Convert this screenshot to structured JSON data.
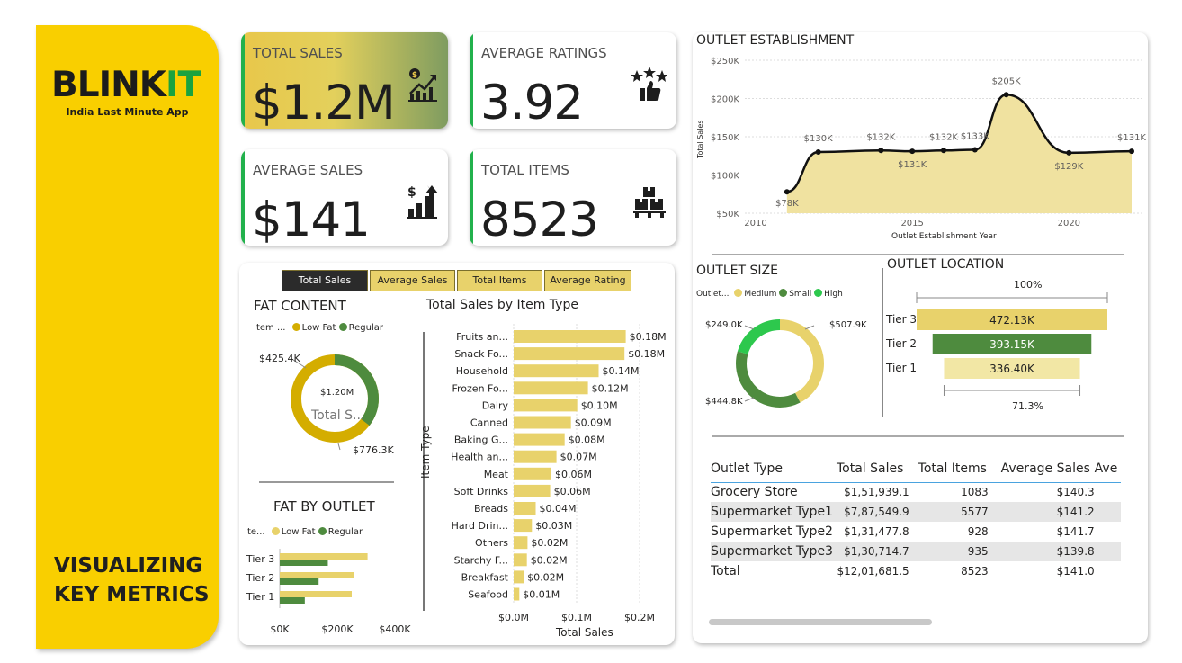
{
  "sidebar": {
    "brand_main": "BLINK",
    "brand_accent": "IT",
    "tagline": "India Last Minute App",
    "title_line1": "VISUALIZING",
    "title_line2": "KEY METRICS"
  },
  "kpis": [
    {
      "label": "TOTAL SALES",
      "value": "$1.2M",
      "icon": "sales-chart-icon"
    },
    {
      "label": "AVERAGE RATINGS",
      "value": "3.92",
      "icon": "rating-thumbs-up-icon"
    },
    {
      "label": "AVERAGE SALES",
      "value": "$141",
      "icon": "average-sales-icon"
    },
    {
      "label": "TOTAL ITEMS",
      "value": "8523",
      "icon": "items-boxes-icon"
    }
  ],
  "tabs": [
    "Total Sales",
    "Average Sales",
    "Total Items",
    "Average Rating"
  ],
  "fat_content": {
    "title": "FAT CONTENT",
    "legend_label": "Item ...",
    "center_value": "$1.20M",
    "center_label": "Total S...",
    "chart_data": {
      "type": "pie",
      "categories": [
        "Low Fat",
        "Regular"
      ],
      "values": [
        776.3,
        425.4
      ],
      "labels": [
        "$776.3K",
        "$425.4K"
      ],
      "total": "$1.20M"
    }
  },
  "fat_by_outlet": {
    "title": "FAT BY OUTLET",
    "legend_label": "Ite...",
    "chart_data": {
      "type": "bar",
      "orientation": "horizontal",
      "categories": [
        "Tier 3",
        "Tier 2",
        "Tier 1"
      ],
      "series": [
        {
          "name": "Low Fat",
          "values": [
            305,
            258,
            250
          ]
        },
        {
          "name": "Regular",
          "values": [
            167,
            135,
            87
          ]
        }
      ],
      "xlim": [
        0,
        400
      ],
      "ticks": [
        "$0K",
        "$200K",
        "$400K"
      ]
    }
  },
  "item_type": {
    "title": "Total Sales by Item Type",
    "ylabel": "Item Type",
    "xlabel": "Total Sales",
    "chart_data": {
      "type": "bar",
      "orientation": "horizontal",
      "categories": [
        "Fruits an...",
        "Snack Fo...",
        "Household",
        "Frozen Fo...",
        "Dairy",
        "Canned",
        "Baking G...",
        "Health an...",
        "Meat",
        "Soft Drinks",
        "Breads",
        "Hard Drin...",
        "Others",
        "Starchy F...",
        "Breakfast",
        "Seafood"
      ],
      "values": [
        0.178,
        0.176,
        0.135,
        0.118,
        0.101,
        0.091,
        0.081,
        0.068,
        0.06,
        0.058,
        0.035,
        0.029,
        0.022,
        0.021,
        0.016,
        0.009
      ],
      "labels": [
        "$0.18M",
        "$0.18M",
        "$0.14M",
        "$0.12M",
        "$0.10M",
        "$0.09M",
        "$0.08M",
        "$0.07M",
        "$0.06M",
        "$0.06M",
        "$0.04M",
        "$0.03M",
        "$0.02M",
        "$0.02M",
        "$0.02M",
        "$0.01M"
      ],
      "xlim": [
        0,
        0.2
      ],
      "ticks": [
        "$0.0M",
        "$0.1M",
        "$0.2M"
      ]
    }
  },
  "establishment": {
    "title": "OUTLET ESTABLISHMENT",
    "ylabel": "Total Sales",
    "xlabel": "Outlet Establishment Year",
    "chart_data": {
      "type": "area",
      "x": [
        2011,
        2012,
        2014,
        2015,
        2016,
        2017,
        2018,
        2020,
        2022
      ],
      "y": [
        78,
        130,
        132,
        131,
        132,
        133,
        205,
        129,
        131
      ],
      "labels": [
        "$78K",
        "$130K",
        "$132K",
        "$131K",
        "$132K",
        "$133K",
        "$205K",
        "$129K",
        "$131K"
      ],
      "ylim": [
        50,
        250
      ],
      "xlim": [
        2010,
        2022
      ],
      "yticks": [
        "$250K",
        "$200K",
        "$150K",
        "$100K",
        "$50K"
      ],
      "xticks": [
        "2010",
        "2015",
        "2020"
      ]
    }
  },
  "outlet_size": {
    "title": "OUTLET SIZE",
    "legend_label": "Outlet...",
    "chart_data": {
      "type": "pie",
      "categories": [
        "Medium",
        "Small",
        "High"
      ],
      "values": [
        507.9,
        444.8,
        249.0
      ],
      "labels": [
        "$507.9K",
        "$444.8K",
        "$249.0K"
      ]
    }
  },
  "outlet_location": {
    "title": "OUTLET LOCATION",
    "top_pct": "100%",
    "bottom_pct": "71.3%",
    "chart_data": {
      "type": "bar",
      "categories": [
        "Tier 3",
        "Tier 2",
        "Tier 1"
      ],
      "values": [
        472.13,
        393.15,
        336.4
      ],
      "labels": [
        "472.13K",
        "393.15K",
        "336.40K"
      ]
    }
  },
  "table": {
    "headers": [
      "Outlet Type",
      "Total Sales",
      "Total Items",
      "Average Sales",
      "Ave"
    ],
    "rows": [
      [
        "Grocery Store",
        "$1,51,939.1",
        "1083",
        "$140.3"
      ],
      [
        "Supermarket Type1",
        "$7,87,549.9",
        "5577",
        "$141.2"
      ],
      [
        "Supermarket Type2",
        "$1,31,477.8",
        "928",
        "$141.7"
      ],
      [
        "Supermarket Type3",
        "$1,30,714.7",
        "935",
        "$139.8"
      ]
    ],
    "total": [
      "Total",
      "$12,01,681.5",
      "8523",
      "$141.0"
    ]
  },
  "colors": {
    "gold": "#d4ad00",
    "green": "#4e8b3e",
    "bright_green": "#2dc84d",
    "bar_yellow": "#e8d26b",
    "yellow": "#f9cf00",
    "pale": "#f2e7a5"
  }
}
